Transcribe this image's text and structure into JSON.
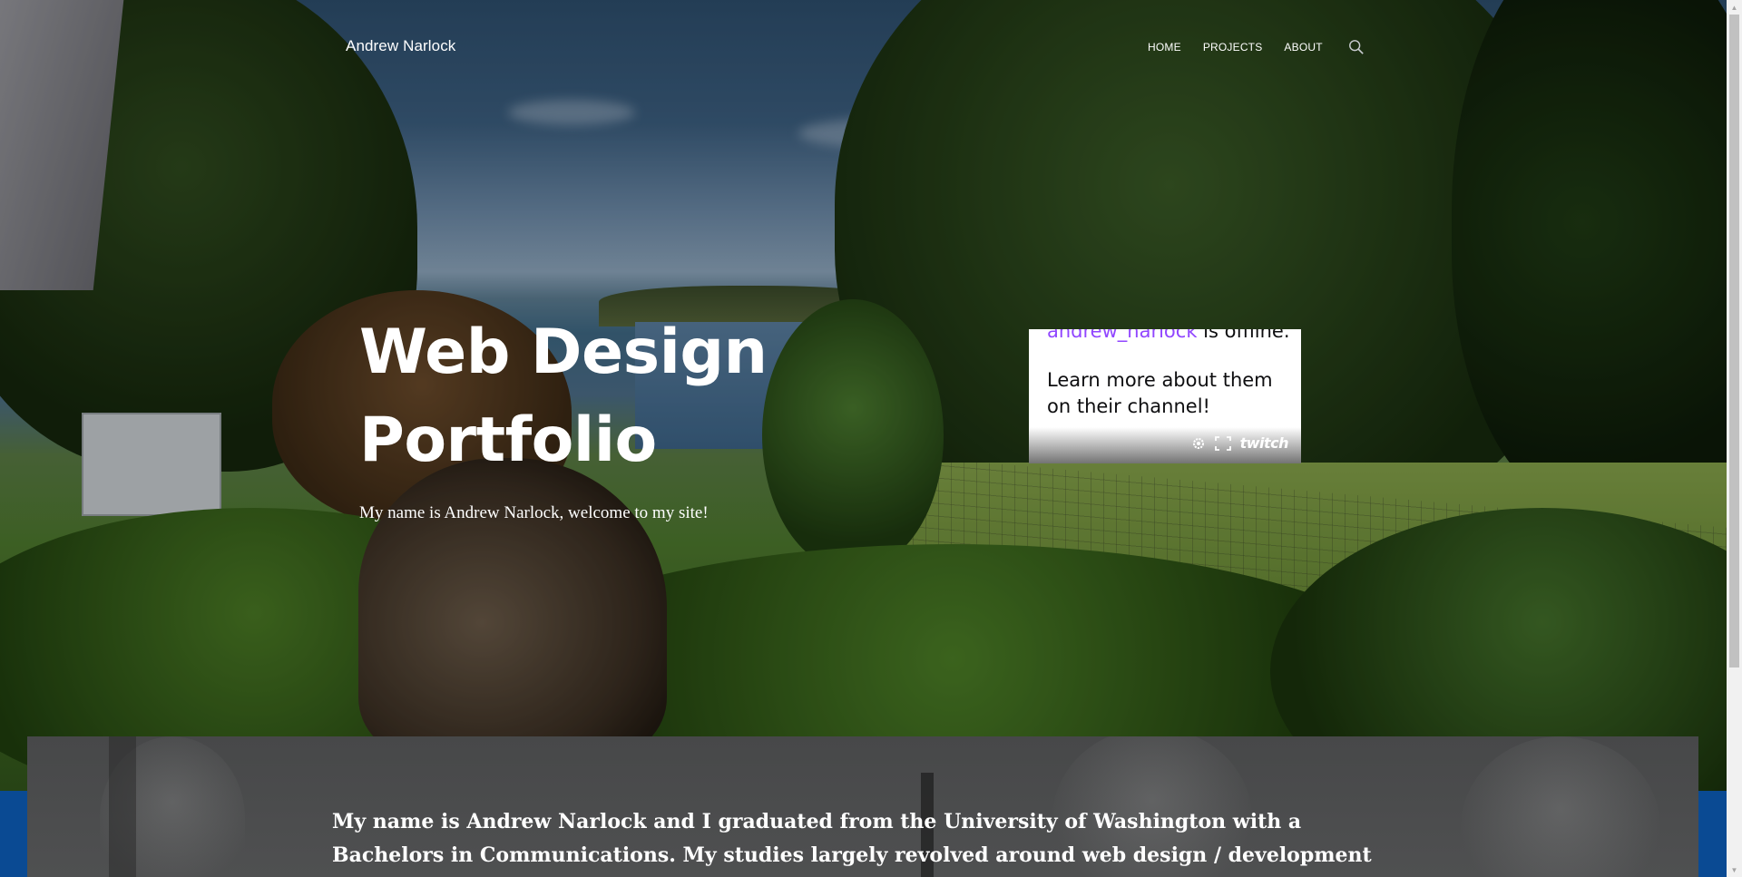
{
  "site": {
    "title": "Andrew Narlock"
  },
  "nav": {
    "items": [
      "HOME",
      "PROJECTS",
      "ABOUT"
    ],
    "search_icon": "search-icon"
  },
  "hero": {
    "title_line1": "Web Design",
    "title_line2": "Portfolio",
    "subtitle": "My name is Andrew Narlock, welcome to my site!"
  },
  "twitch": {
    "username": "andrew_narlock",
    "offline_suffix": " is offline.",
    "learn_more": "Learn more about them on their channel!",
    "logo": "twitch",
    "icons": [
      "settings-icon",
      "fullscreen-icon"
    ],
    "accent": "#9146ff"
  },
  "about": {
    "text": "My name is Andrew Narlock and I graduated from the University of Washington with a Bachelors in Communications. My studies largely revolved around web design / development by understanding and"
  },
  "colors": {
    "footer_band": "#0a4a93",
    "about_panel": "#4a4b4c"
  }
}
